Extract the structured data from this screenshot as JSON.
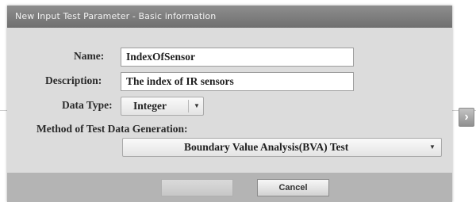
{
  "dialog": {
    "title": "New Input Test Parameter - Basic information"
  },
  "form": {
    "name_label": "Name:",
    "name_value": "IndexOfSensor",
    "description_label": "Description:",
    "description_value": "The index of IR sensors",
    "data_type_label": "Data Type:",
    "data_type_value": "Integer",
    "method_label": "Method of Test Data Generation:",
    "method_value": "Boundary Value Analysis(BVA) Test"
  },
  "footer": {
    "ok_label": "",
    "cancel_label": "Cancel"
  },
  "icons": {
    "dropdown": "chevron-down-icon",
    "next": "chevron-right-icon"
  }
}
